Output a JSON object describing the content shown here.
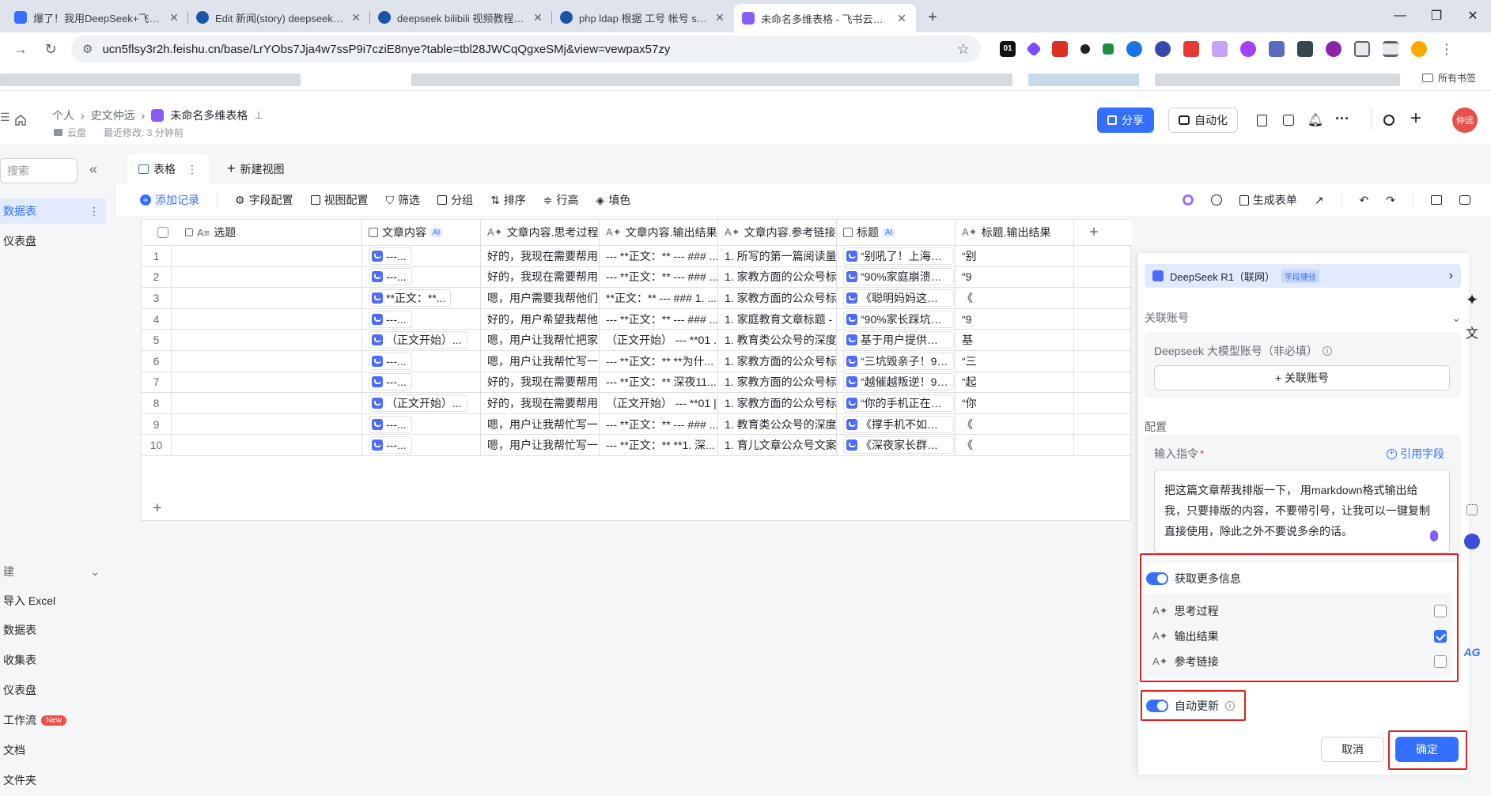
{
  "browser": {
    "tabs": [
      {
        "title": "爆了！我用DeepSeek+飞书, 1",
        "color": "#3370ff"
      },
      {
        "title": "Edit 新闻(story) deepseek bili",
        "color": "#1a56a8"
      },
      {
        "title": "deepseek bilibili 视频教程 有?",
        "color": "#1a56a8"
      },
      {
        "title": "php ldap 根据 工号 帐号 sama",
        "color": "#1a56a8"
      },
      {
        "title": "未命名多维表格 - 飞书云文档",
        "color": "#8a5cf6"
      }
    ],
    "close_glyph": "✕",
    "new_tab": "+",
    "url": "ucn5flsy3r2h.feishu.cn/base/LrYObs7Jja4w7ssP9i7cziE8nye?table=tbl28JWCqQgxeSMj&view=vewpax57zy",
    "bookmarks_folder": "所有书签",
    "ext_badge": "01"
  },
  "header": {
    "crumb_personal": "个人",
    "crumb_user": "史文仲远",
    "doc_title": "未命名多维表格",
    "location": "云盘",
    "last_modified": "最近修改: 3 分钟前",
    "share": "分享",
    "automation": "自动化",
    "avatar": "仲远",
    "more": "···"
  },
  "sidebar": {
    "search_placeholder": "搜索",
    "items": [
      "数据表",
      "仪表盘"
    ],
    "new_section": "建",
    "create_items": [
      "导入 Excel",
      "数据表",
      "收集表",
      "仪表盘",
      "工作流",
      "文档",
      "文件夹"
    ],
    "new_badge": "New"
  },
  "views": {
    "table_tab": "表格",
    "new_view": "新建视图"
  },
  "toolbar": {
    "add_record": "添加记录",
    "field_config": "字段配置",
    "view_config": "视图配置",
    "filter": "筛选",
    "group": "分组",
    "sort": "排序",
    "row_height": "行高",
    "fill_color": "填色",
    "generate_form": "生成表单"
  },
  "grid": {
    "columns": [
      "选题",
      "文章内容",
      "文章内容.思考过程",
      "文章内容.输出结果",
      "文章内容.参考链接",
      "标题",
      "标题.输出结果"
    ],
    "ai_tag": "AI",
    "rows": [
      {
        "n": "1",
        "c1": "---...",
        "c2": "好的，我现在需要帮用...",
        "c3": "--- **正文：** --- ### ...",
        "c4": "1. 所写的第一篇阅读量1...",
        "c5": "“别吼了！上海妈妈...",
        "c6": "“别"
      },
      {
        "n": "2",
        "c1": "---...",
        "c2": "好的，我现在需要帮用...",
        "c3": "--- **正文：** --- ### ...",
        "c4": "1. 家教方面的公众号标...",
        "c5": "“90%家庭崩溃的3...",
        "c6": "“9"
      },
      {
        "n": "3",
        "c1": "**正文：**...",
        "c2": "嗯，用户需要我帮他们...",
        "c3": "**正文：** --- ### 1. ...",
        "c4": "1. 家教方面的公众号标...",
        "c5": "《聪明妈妈这样做...",
        "c6": "《"
      },
      {
        "n": "4",
        "c1": "---...",
        "c2": "好的，用户希望我帮他...",
        "c3": "--- **正文：** --- ### ...",
        "c4": "1. 家庭教育文章标题 - ...",
        "c5": "“90%家长踩坑的7...",
        "c6": "“9"
      },
      {
        "n": "5",
        "c1": "（正文开始）...",
        "c2": "嗯，用户让我帮忙把家...",
        "c3": "（正文开始） --- **01 ...",
        "c4": "1. 教育类公众号的深度...",
        "c5": "基于用户提供的详...",
        "c6": "基"
      },
      {
        "n": "6",
        "c1": "---...",
        "c2": "嗯，用户让我帮忙写一...",
        "c3": "--- **正文：** **为什...",
        "c4": "1. 家教方面的公众号标...",
        "c5": "“三坑毁亲子！90...",
        "c6": "“三"
      },
      {
        "n": "7",
        "c1": "---...",
        "c2": "好的，我现在需要帮用...",
        "c3": "--- **正文：** 深夜11...",
        "c4": "1. 家教方面的公众号标...",
        "c5": "“越催越叛逆！90...",
        "c6": "“起"
      },
      {
        "n": "8",
        "c1": "（正文开始）...",
        "c2": "好的，我现在需要帮用...",
        "c3": "（正文开始） --- **01 |...",
        "c4": "1. 家教方面的公众号标...",
        "c5": "“你的手机正在偷走...",
        "c6": "“你"
      },
      {
        "n": "9",
        "c1": "---...",
        "c2": "嗯，用户让我帮忙写一...",
        "c3": "--- **正文：** --- ### ...",
        "c4": "1. 教育类公众号的深度...",
        "c5": "《撑手机不如撕公...",
        "c6": "《"
      },
      {
        "n": "10",
        "c1": "---...",
        "c2": "嗯，用户让我帮忙写一...",
        "c3": "--- **正文：** **1. 深...",
        "c4": "1. 育儿文章公众号文案...",
        "c5": "《深夜家长群的崩...",
        "c6": "《"
      }
    ]
  },
  "panel": {
    "model_name": "DeepSeek R1（联网）",
    "model_tag": "字段捷径",
    "linked_account": "关联账号",
    "account_label": "Deepseek 大模型账号（非必填）",
    "link_account_btn": "+ 关联账号",
    "config": "配置",
    "instruction_label": "输入指令",
    "required_mark": "*",
    "ref_field": "引用字段",
    "instruction_text": "把这篇文章帮我排版一下， 用markdown格式输出给我，只要排版的内容，不要带引号，让我可以一键复制直接使用，除此之外不要说多余的话。",
    "more_info": "获取更多信息",
    "options": [
      {
        "label": "思考过程",
        "checked": false
      },
      {
        "label": "输出结果",
        "checked": true
      },
      {
        "label": "参考链接",
        "checked": false
      }
    ],
    "auto_update": "自动更新",
    "cancel": "取消",
    "confirm": "确定"
  },
  "colors": {
    "accent": "#3370ff",
    "highlight_red": "#e02020",
    "avatar_bg": "#e8514a"
  }
}
